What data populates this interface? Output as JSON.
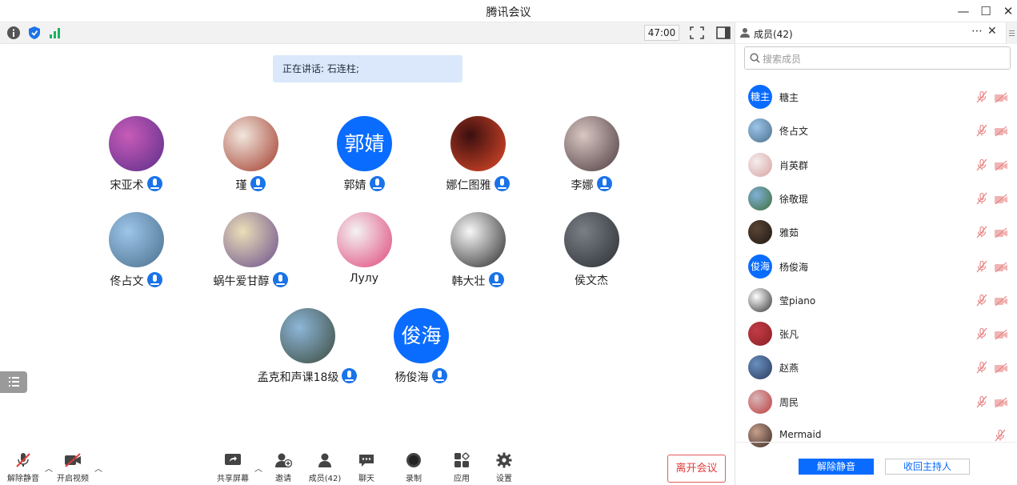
{
  "window": {
    "title": "腾讯会议",
    "min": "—",
    "max": "☐",
    "close": "✕"
  },
  "toolbar": {
    "timer": "47:00"
  },
  "main": {
    "speaking": "正在讲话: 石连柱;",
    "participants": [
      {
        "name": "宋亚术",
        "avatar_text": "",
        "avatar_colors": [
          "#c85bb8",
          "#5b2f8a"
        ],
        "mic_on": true
      },
      {
        "name": "瑾",
        "avatar_text": "",
        "avatar_colors": [
          "#f1e7de",
          "#a23a2a"
        ],
        "mic_on": true
      },
      {
        "name": "郭婧",
        "avatar_text": "郭婧",
        "avatar_colors": [
          "#0a6cff",
          "#0a6cff"
        ],
        "mic_on": true
      },
      {
        "name": "娜仁图雅",
        "avatar_text": "",
        "avatar_colors": [
          "#3a0f0f",
          "#e24a2a"
        ],
        "mic_on": true
      },
      {
        "name": "李娜",
        "avatar_text": "",
        "avatar_colors": [
          "#d8c7c2",
          "#4c3a3f"
        ],
        "mic_on": true
      },
      {
        "name": "佟占文",
        "avatar_text": "",
        "avatar_colors": [
          "#9dc5e8",
          "#4a6f8c"
        ],
        "mic_on": true
      },
      {
        "name": "蜗牛爱甘醇",
        "avatar_text": "",
        "avatar_colors": [
          "#eadfb8",
          "#6b4e8c"
        ],
        "mic_on": true
      },
      {
        "name": "Лулу",
        "avatar_text": "",
        "avatar_colors": [
          "#f3f3f3",
          "#e0457a"
        ],
        "mic_on": false
      },
      {
        "name": "韩大壮",
        "avatar_text": "",
        "avatar_colors": [
          "#f7f7f7",
          "#2a2a2a"
        ],
        "mic_on": true
      },
      {
        "name": "侯文杰",
        "avatar_text": "",
        "avatar_colors": [
          "#7a7f86",
          "#2b2f33"
        ],
        "mic_on": false
      },
      {
        "name": "孟克和声课18级",
        "avatar_text": "",
        "avatar_colors": [
          "#8db6d8",
          "#3b4a3c"
        ],
        "mic_on": true
      },
      {
        "name": "杨俊海",
        "avatar_text": "俊海",
        "avatar_colors": [
          "#0a6cff",
          "#0a6cff"
        ],
        "mic_on": true
      }
    ]
  },
  "bottom": {
    "unmute": "解除静音",
    "video": "开启视频",
    "share": "共享屏幕",
    "invite": "邀请",
    "members": "成员(42)",
    "chat": "聊天",
    "record": "录制",
    "apps": "应用",
    "settings": "设置",
    "leave": "离开会议"
  },
  "panel": {
    "title": "成员(42)",
    "more": "⋯",
    "close": "✕",
    "search_placeholder": "搜索成员",
    "members": [
      {
        "name": "糖主",
        "avatar_text": "糖主",
        "avatar_colors": [
          "#0a6cff",
          "#0a6cff"
        ],
        "cam": true
      },
      {
        "name": "佟占文",
        "avatar_text": "",
        "avatar_colors": [
          "#9dc5e8",
          "#4a6f8c"
        ],
        "cam": true
      },
      {
        "name": "肖英群",
        "avatar_text": "",
        "avatar_colors": [
          "#f4eeee",
          "#d8a0a0"
        ],
        "cam": true
      },
      {
        "name": "徐敬琨",
        "avatar_text": "",
        "avatar_colors": [
          "#7fb0d8",
          "#3f6e35"
        ],
        "cam": true
      },
      {
        "name": "雅茹",
        "avatar_text": "",
        "avatar_colors": [
          "#5a4535",
          "#1e1814"
        ],
        "cam": true
      },
      {
        "name": "杨俊海",
        "avatar_text": "俊海",
        "avatar_colors": [
          "#0a6cff",
          "#0a6cff"
        ],
        "cam": true
      },
      {
        "name": "莹piano",
        "avatar_text": "",
        "avatar_colors": [
          "#ffffff",
          "#333333"
        ],
        "cam": true
      },
      {
        "name": "张凡",
        "avatar_text": "",
        "avatar_colors": [
          "#c33d45",
          "#8a1e25"
        ],
        "cam": true
      },
      {
        "name": "赵燕",
        "avatar_text": "",
        "avatar_colors": [
          "#6a8fbf",
          "#2a3c5e"
        ],
        "cam": true
      },
      {
        "name": "周民",
        "avatar_text": "",
        "avatar_colors": [
          "#d9b6b8",
          "#bb3d3d"
        ],
        "cam": true
      },
      {
        "name": "Mermaid",
        "avatar_text": "",
        "avatar_colors": [
          "#c9a08b",
          "#3a2a28"
        ],
        "cam": false
      }
    ],
    "unmute_all": "解除静音",
    "reclaim_host": "收回主持人"
  }
}
